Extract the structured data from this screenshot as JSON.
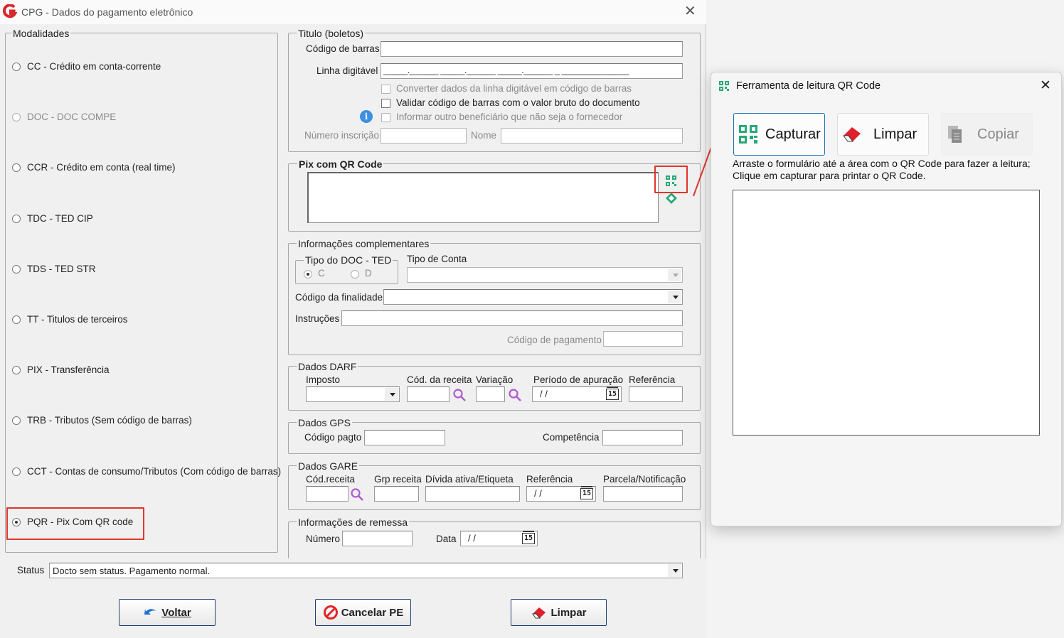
{
  "main": {
    "title": "CPG - Dados do pagamento eletrônico",
    "modalidades": {
      "legend": "Modalidades",
      "options": [
        {
          "label": "CC  - Crédito em conta-corrente",
          "enabled": true,
          "selected": false
        },
        {
          "label": "DOC - DOC COMPE",
          "enabled": false,
          "selected": false
        },
        {
          "label": "CCR - Crédito em conta (real time)",
          "enabled": true,
          "selected": false
        },
        {
          "label": "TDC - TED CIP",
          "enabled": true,
          "selected": false
        },
        {
          "label": "TDS - TED STR",
          "enabled": true,
          "selected": false
        },
        {
          "label": "TT  - Titulos de terceiros",
          "enabled": true,
          "selected": false
        },
        {
          "label": "PIX - Transferência",
          "enabled": true,
          "selected": false
        },
        {
          "label": "TRB - Tributos (Sem código de barras)",
          "enabled": true,
          "selected": false
        },
        {
          "label": "CCT - Contas de consumo/Tributos (Com código de barras)",
          "enabled": true,
          "selected": false
        },
        {
          "label": "PQR - Pix Com QR code",
          "enabled": true,
          "selected": true
        }
      ]
    },
    "titulo": {
      "legend": "Titulo (boletos)",
      "codigo_barras_label": "Código de barras",
      "linha_digitavel_label": "Linha digitável",
      "linha_digitavel_mask": "_____.______ _____.______ _____.______ _ ______________",
      "chk_converter": "Converter dados da linha digitável em código de barras",
      "chk_validar": "Validar código de barras com o valor bruto do documento",
      "chk_informar": "Informar outro beneficiário que não seja o fornecedor",
      "numero_inscricao_label": "Número inscrição",
      "nome_label": "Nome"
    },
    "pix": {
      "legend": "Pix com QR Code"
    },
    "info": {
      "legend": "Informações complementares",
      "tipo_doc_legend": "Tipo do DOC - TED",
      "radio_c": "C",
      "radio_d": "D",
      "tipo_conta_label": "Tipo de Conta",
      "codigo_finalidade_label": "Código da finalidade",
      "instrucoes_label": "Instruções",
      "codigo_pagamento_label": "Código de pagamento"
    },
    "darf": {
      "legend": "Dados DARF",
      "imposto": "Imposto",
      "cod_receita": "Cód. da receita",
      "variacao": "Variação",
      "periodo": "Período de apuração",
      "referencia": "Referência",
      "date_mask": "/ /"
    },
    "gps": {
      "legend": "Dados GPS",
      "codigo_pagto": "Código pagto",
      "competencia": "Competência"
    },
    "gare": {
      "legend": "Dados GARE",
      "cod_receita": "Cód.receita",
      "grp_receita": "Grp receita",
      "divida": "Dívida ativa/Etiqueta",
      "referencia": "Referência",
      "parcela": "Parcela/Notificação",
      "date_mask": "/ /"
    },
    "remessa": {
      "legend": "Informações de remessa",
      "numero": "Número",
      "data": "Data",
      "date_mask": "/ /"
    },
    "status": {
      "label": "Status",
      "value": "Docto sem status. Pagamento normal."
    },
    "buttons": {
      "voltar": "Voltar",
      "cancelar": "Cancelar PE",
      "limpar": "Limpar"
    },
    "calendar_day": "15"
  },
  "qr_tool": {
    "title": "Ferramenta de leitura QR Code",
    "capturar": "Capturar",
    "limpar": "Limpar",
    "copiar": "Copiar",
    "instr1": "Arraste o formulário até a área com o QR Code para fazer a leitura;",
    "instr2": "Clique em capturar para printar o QR Code."
  },
  "colors": {
    "highlight": "#e0352b",
    "brand": "#d7262c",
    "qr_green": "#2aa876"
  }
}
